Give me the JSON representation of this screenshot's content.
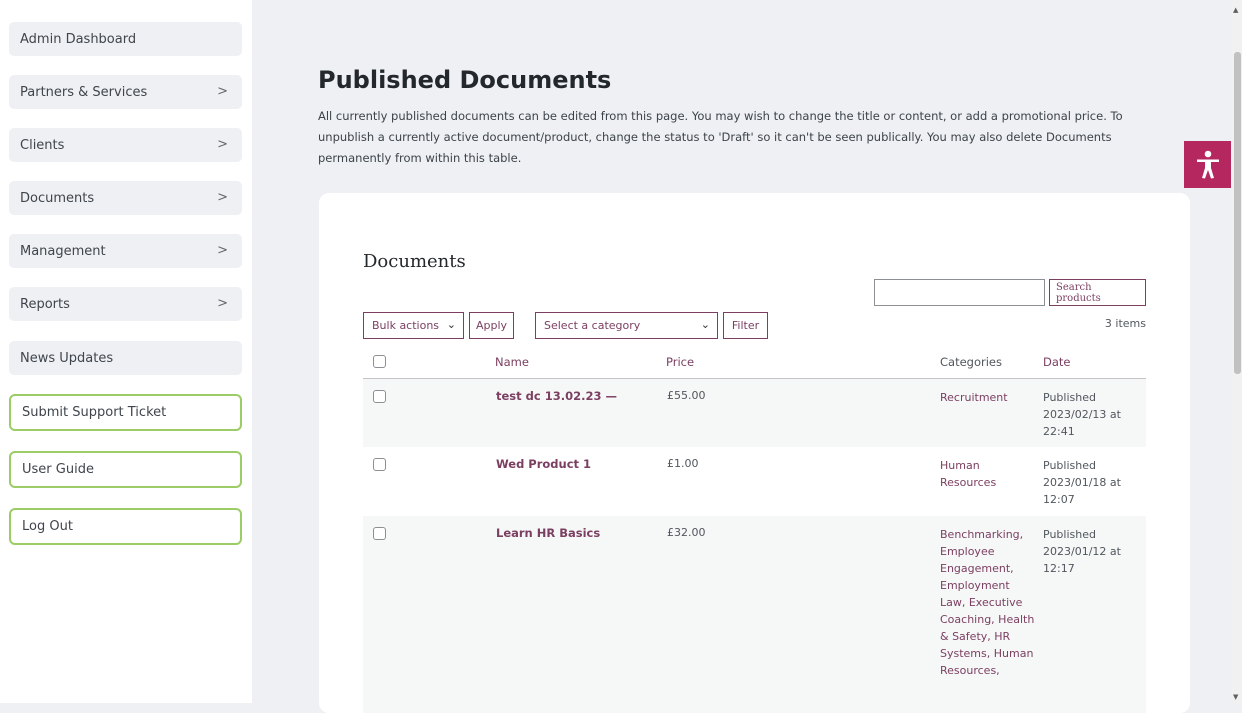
{
  "sidebar": {
    "items": [
      {
        "label": "Admin Dashboard",
        "chevron": false
      },
      {
        "label": "Partners & Services",
        "chevron": true
      },
      {
        "label": "Clients",
        "chevron": true
      },
      {
        "label": "Documents",
        "chevron": true
      },
      {
        "label": "Management",
        "chevron": true
      },
      {
        "label": "Reports",
        "chevron": true
      },
      {
        "label": "News Updates",
        "chevron": false
      }
    ],
    "outlined_items": [
      {
        "label": "Submit Support Ticket"
      },
      {
        "label": "User Guide"
      },
      {
        "label": "Log Out"
      }
    ],
    "chevron_glyph": ">"
  },
  "main": {
    "title": "Published Documents",
    "description": "All currently published documents can be edited from this page. You may wish to change the title or content, or add a promotional price. To unpublish a currently active document/product, change the status to 'Draft' so it can't be seen publically. You may also delete Documents permanently from within this table."
  },
  "documents": {
    "heading": "Documents",
    "search": {
      "value": "",
      "button_label": "Search products"
    },
    "bulk_actions": {
      "selected": "Bulk actions"
    },
    "apply_label": "Apply",
    "category_select": {
      "selected": "Select a category"
    },
    "filter_label": "Filter",
    "items_count": "3 items",
    "columns": {
      "name": "Name",
      "price": "Price",
      "categories": "Categories",
      "date": "Date"
    },
    "rows": [
      {
        "name": "test dc 13.02.23 —",
        "price": "£55.00",
        "categories": "Recruitment",
        "date": "Published 2023/02/13 at 22:41"
      },
      {
        "name": "Wed Product 1",
        "price": "£1.00",
        "categories": "Human Resources",
        "date": "Published 2023/01/18 at 12:07"
      },
      {
        "name": "Learn HR Basics",
        "price": "£32.00",
        "categories": "Benchmarking, Employee Engagement, Employment Law, Executive Coaching, Health & Safety, HR Systems, Human Resources,",
        "date": "Published 2023/01/12 at 12:17"
      }
    ]
  },
  "accessibility": {
    "icon": "accessibility-icon",
    "color": "#b4275f"
  },
  "colors": {
    "accent": "#7b3f61",
    "outline_green": "#9ccc65",
    "background": "#eef0f3"
  }
}
